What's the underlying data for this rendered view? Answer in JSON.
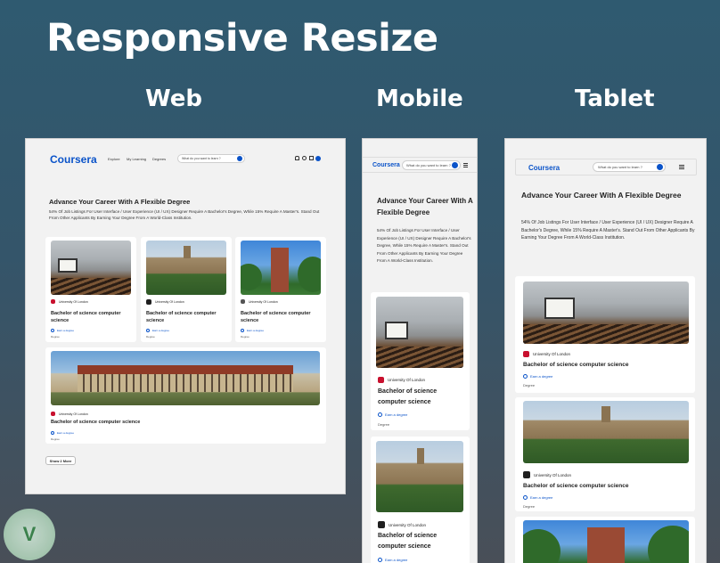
{
  "heading": "Responsive Resize",
  "columns": {
    "web": "Web",
    "mobile": "Mobile",
    "tablet": "Tablet"
  },
  "brand": "Coursera",
  "nav": {
    "explore": "Explore",
    "my_learning": "My Learning",
    "degrees": "Degrees"
  },
  "search": {
    "placeholder": "What do you want to learn ?"
  },
  "hero": {
    "title": "Advance Your Career With A Flexible Degree",
    "description": "54% Of Job Listings For User Interface / User Experience (UI / UX) Designer Require A Bachelor's Degree, While 15% Require A Master's. Stand Out From Other Applicants By Earning Your Degree From A World-Class Institution."
  },
  "card": {
    "university": "University Of London",
    "title": "Bachelor of science computer science",
    "earn": "Earn a degree",
    "type": "Degree"
  },
  "show_more": "Show 2 More"
}
